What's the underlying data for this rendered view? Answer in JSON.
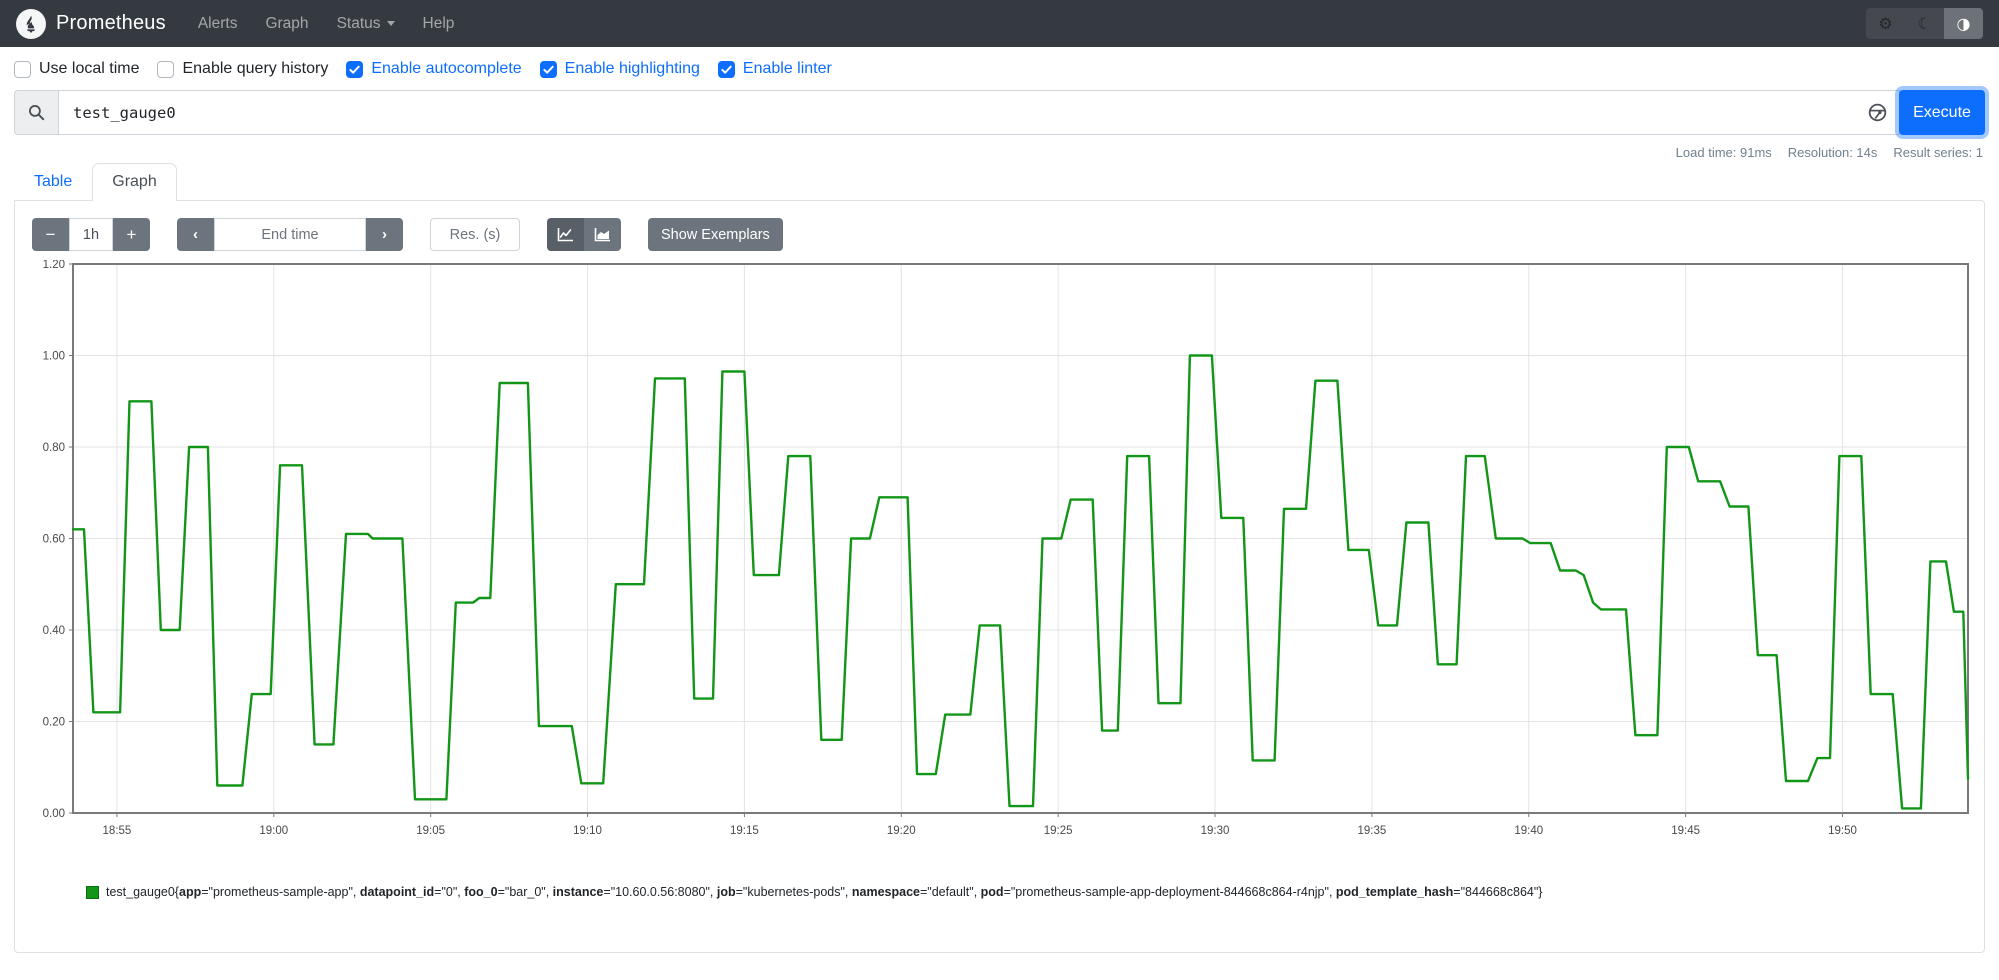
{
  "navbar": {
    "brand": "Prometheus",
    "items": [
      {
        "label": "Alerts",
        "caret": false
      },
      {
        "label": "Graph",
        "caret": false
      },
      {
        "label": "Status",
        "caret": true
      },
      {
        "label": "Help",
        "caret": false
      }
    ],
    "theme_buttons": [
      {
        "name": "settings",
        "glyph": "⚙",
        "active": false
      },
      {
        "name": "dark-mode",
        "glyph": "☾",
        "active": false
      },
      {
        "name": "auto-contrast",
        "glyph": "◑",
        "active": true
      }
    ]
  },
  "settings": {
    "checkboxes": [
      {
        "label": "Use local time",
        "checked": false
      },
      {
        "label": "Enable query history",
        "checked": false
      },
      {
        "label": "Enable autocomplete",
        "checked": true
      },
      {
        "label": "Enable highlighting",
        "checked": true
      },
      {
        "label": "Enable linter",
        "checked": true
      }
    ]
  },
  "query": {
    "value": "test_gauge0",
    "execute_label": "Execute"
  },
  "stats": {
    "load_time": "Load time: 91ms",
    "resolution": "Resolution: 14s",
    "result_series": "Result series: 1"
  },
  "tabs": {
    "table": "Table",
    "graph": "Graph"
  },
  "graph_controls": {
    "minus": "−",
    "range_value": "1h",
    "plus": "+",
    "back": "‹",
    "end_time_placeholder": "End time",
    "forward": "›",
    "res_placeholder": "Res. (s)",
    "show_exemplars": "Show Exemplars"
  },
  "chart_data": {
    "type": "line",
    "line_style": "step",
    "color": "#129618",
    "grid": true,
    "title": "",
    "xlabel": "",
    "ylabel": "",
    "ylim": [
      0,
      1.2
    ],
    "yticks": [
      "0.00",
      "0.20",
      "0.40",
      "0.60",
      "0.80",
      "1.00",
      "1.20"
    ],
    "xrange_minutes": 60.4,
    "xticks": [
      {
        "t": 1.4,
        "label": "18:55"
      },
      {
        "t": 6.4,
        "label": "19:00"
      },
      {
        "t": 11.4,
        "label": "19:05"
      },
      {
        "t": 16.4,
        "label": "19:10"
      },
      {
        "t": 21.4,
        "label": "19:15"
      },
      {
        "t": 26.4,
        "label": "19:20"
      },
      {
        "t": 31.4,
        "label": "19:25"
      },
      {
        "t": 36.4,
        "label": "19:30"
      },
      {
        "t": 41.4,
        "label": "19:35"
      },
      {
        "t": 46.4,
        "label": "19:40"
      },
      {
        "t": 51.4,
        "label": "19:45"
      },
      {
        "t": 56.4,
        "label": "19:50"
      }
    ],
    "series": [
      {
        "name": "test_gauge0",
        "points": [
          [
            0,
            0.62
          ],
          [
            0.35,
            0.62
          ],
          [
            0.65,
            0.22
          ],
          [
            1.5,
            0.22
          ],
          [
            1.8,
            0.9
          ],
          [
            2.5,
            0.9
          ],
          [
            2.8,
            0.4
          ],
          [
            3.4,
            0.4
          ],
          [
            3.7,
            0.8
          ],
          [
            4.3,
            0.8
          ],
          [
            4.6,
            0.06
          ],
          [
            5.4,
            0.06
          ],
          [
            5.7,
            0.26
          ],
          [
            6.3,
            0.26
          ],
          [
            6.6,
            0.76
          ],
          [
            7.3,
            0.76
          ],
          [
            7.7,
            0.15
          ],
          [
            8.3,
            0.15
          ],
          [
            8.7,
            0.61
          ],
          [
            9.4,
            0.61
          ],
          [
            9.55,
            0.6
          ],
          [
            10.5,
            0.6
          ],
          [
            10.9,
            0.03
          ],
          [
            11.9,
            0.03
          ],
          [
            12.2,
            0.46
          ],
          [
            12.75,
            0.46
          ],
          [
            12.95,
            0.47
          ],
          [
            13.3,
            0.47
          ],
          [
            13.6,
            0.94
          ],
          [
            14.5,
            0.94
          ],
          [
            14.85,
            0.19
          ],
          [
            15.9,
            0.19
          ],
          [
            16.2,
            0.065
          ],
          [
            16.9,
            0.065
          ],
          [
            17.3,
            0.5
          ],
          [
            18.2,
            0.5
          ],
          [
            18.55,
            0.95
          ],
          [
            19.5,
            0.95
          ],
          [
            19.8,
            0.25
          ],
          [
            20.4,
            0.25
          ],
          [
            20.7,
            0.965
          ],
          [
            21.4,
            0.965
          ],
          [
            21.7,
            0.52
          ],
          [
            22.5,
            0.52
          ],
          [
            22.8,
            0.78
          ],
          [
            23.5,
            0.78
          ],
          [
            23.85,
            0.16
          ],
          [
            24.5,
            0.16
          ],
          [
            24.8,
            0.6
          ],
          [
            25.4,
            0.6
          ],
          [
            25.7,
            0.69
          ],
          [
            26.6,
            0.69
          ],
          [
            26.9,
            0.085
          ],
          [
            27.5,
            0.085
          ],
          [
            27.8,
            0.215
          ],
          [
            28.6,
            0.215
          ],
          [
            28.9,
            0.41
          ],
          [
            29.55,
            0.41
          ],
          [
            29.85,
            0.015
          ],
          [
            30.6,
            0.015
          ],
          [
            30.9,
            0.6
          ],
          [
            31.5,
            0.6
          ],
          [
            31.8,
            0.685
          ],
          [
            32.5,
            0.685
          ],
          [
            32.8,
            0.18
          ],
          [
            33.3,
            0.18
          ],
          [
            33.6,
            0.78
          ],
          [
            34.3,
            0.78
          ],
          [
            34.6,
            0.24
          ],
          [
            35.3,
            0.24
          ],
          [
            35.6,
            1.0
          ],
          [
            36.3,
            1.0
          ],
          [
            36.6,
            0.645
          ],
          [
            37.3,
            0.645
          ],
          [
            37.6,
            0.115
          ],
          [
            38.3,
            0.115
          ],
          [
            38.6,
            0.665
          ],
          [
            39.3,
            0.665
          ],
          [
            39.6,
            0.945
          ],
          [
            40.3,
            0.945
          ],
          [
            40.65,
            0.575
          ],
          [
            41.3,
            0.575
          ],
          [
            41.6,
            0.41
          ],
          [
            42.2,
            0.41
          ],
          [
            42.5,
            0.635
          ],
          [
            43.2,
            0.635
          ],
          [
            43.5,
            0.325
          ],
          [
            44.1,
            0.325
          ],
          [
            44.4,
            0.78
          ],
          [
            45.0,
            0.78
          ],
          [
            45.35,
            0.6
          ],
          [
            46.2,
            0.6
          ],
          [
            46.45,
            0.59
          ],
          [
            47.1,
            0.59
          ],
          [
            47.4,
            0.53
          ],
          [
            47.9,
            0.53
          ],
          [
            48.15,
            0.52
          ],
          [
            48.45,
            0.46
          ],
          [
            48.7,
            0.445
          ],
          [
            49.5,
            0.445
          ],
          [
            49.8,
            0.17
          ],
          [
            50.5,
            0.17
          ],
          [
            50.8,
            0.8
          ],
          [
            51.5,
            0.8
          ],
          [
            51.8,
            0.725
          ],
          [
            52.5,
            0.725
          ],
          [
            52.8,
            0.67
          ],
          [
            53.4,
            0.67
          ],
          [
            53.7,
            0.345
          ],
          [
            54.3,
            0.345
          ],
          [
            54.6,
            0.07
          ],
          [
            55.3,
            0.07
          ],
          [
            55.6,
            0.12
          ],
          [
            56.0,
            0.12
          ],
          [
            56.3,
            0.78
          ],
          [
            57.0,
            0.78
          ],
          [
            57.3,
            0.26
          ],
          [
            58.0,
            0.26
          ],
          [
            58.3,
            0.01
          ],
          [
            58.9,
            0.01
          ],
          [
            59.2,
            0.55
          ],
          [
            59.7,
            0.55
          ],
          [
            59.95,
            0.44
          ],
          [
            60.25,
            0.44
          ],
          [
            60.4,
            0.075
          ]
        ]
      }
    ]
  },
  "legend": {
    "metric": "test_gauge0",
    "labels": [
      {
        "key": "app",
        "value": "prometheus-sample-app"
      },
      {
        "key": "datapoint_id",
        "value": "0"
      },
      {
        "key": "foo_0",
        "value": "bar_0"
      },
      {
        "key": "instance",
        "value": "10.60.0.56:8080"
      },
      {
        "key": "job",
        "value": "kubernetes-pods"
      },
      {
        "key": "namespace",
        "value": "default"
      },
      {
        "key": "pod",
        "value": "prometheus-sample-app-deployment-844668c864-r4njp"
      },
      {
        "key": "pod_template_hash",
        "value": "844668c864"
      }
    ]
  }
}
